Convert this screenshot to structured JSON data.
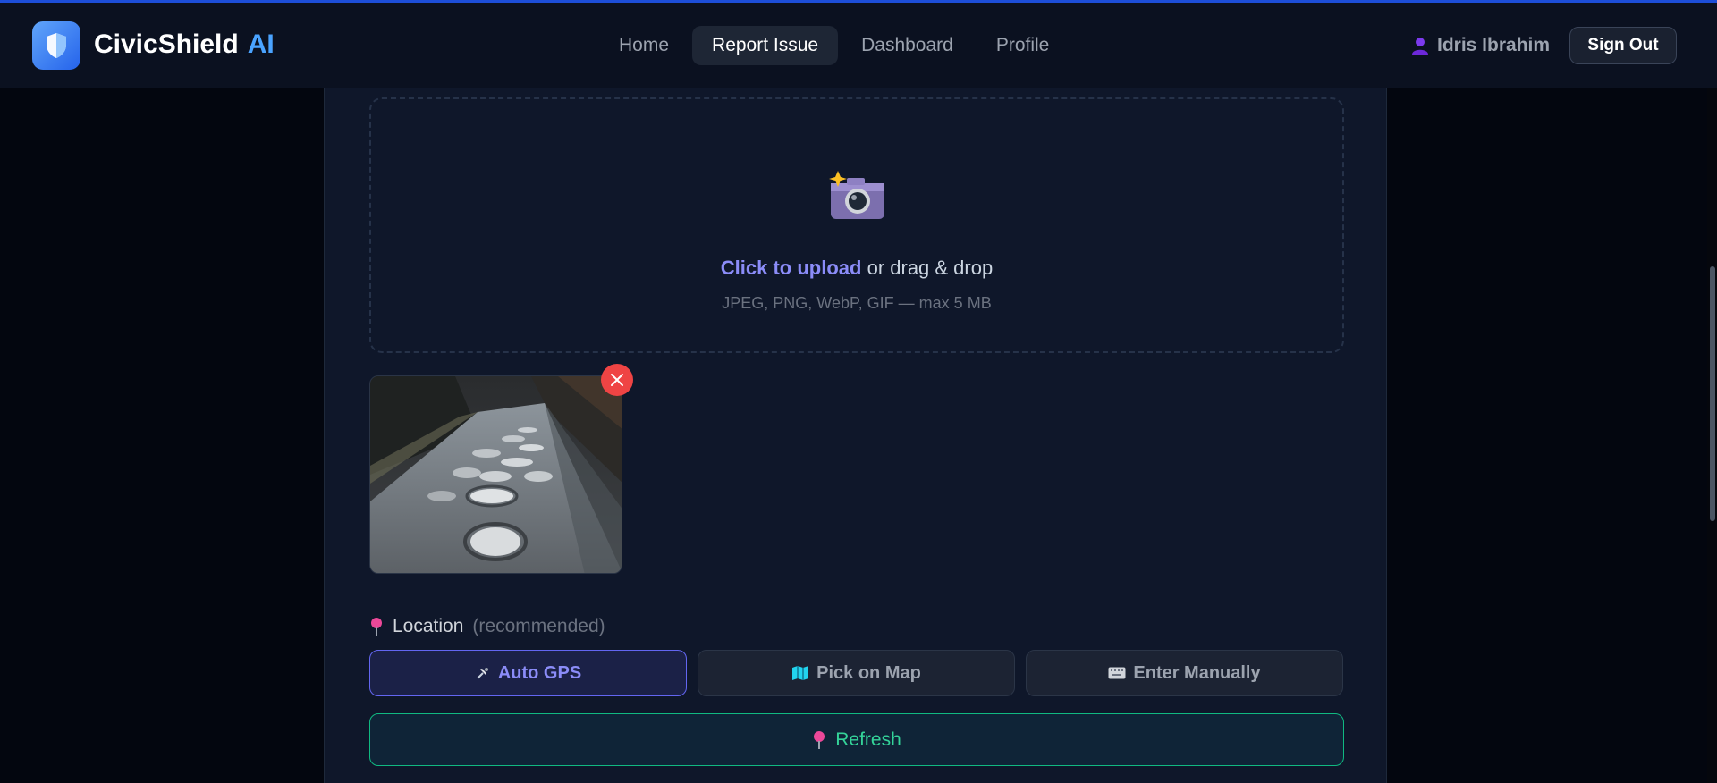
{
  "app": {
    "brand_name": "CivicShield",
    "brand_suffix": "AI",
    "logo_icon": "shield-icon",
    "accent_color": "#4aa3ff"
  },
  "nav": {
    "items": [
      {
        "label": "Home",
        "active": false
      },
      {
        "label": "Report Issue",
        "active": true
      },
      {
        "label": "Dashboard",
        "active": false
      },
      {
        "label": "Profile",
        "active": false
      }
    ]
  },
  "user": {
    "name": "Idris Ibrahim",
    "icon": "user-icon",
    "sign_out_label": "Sign Out"
  },
  "upload": {
    "icon": "camera-icon",
    "link_text": "Click to upload",
    "rest_text": " or drag & drop",
    "hint": "JPEG, PNG, WebP, GIF — max 5 MB"
  },
  "preview": {
    "remove_icon": "close-icon",
    "image_icon": "pothole-road-photo"
  },
  "location": {
    "icon": "pin-icon",
    "label": "Location",
    "hint": "(recommended)",
    "options": [
      {
        "label": "Auto GPS",
        "icon": "satellite-icon",
        "active": true
      },
      {
        "label": "Pick on Map",
        "icon": "map-icon",
        "active": false
      },
      {
        "label": "Enter Manually",
        "icon": "keyboard-icon",
        "active": false
      }
    ],
    "refresh_label": "Refresh",
    "refresh_icon": "pin-icon",
    "refresh_color": "#34d399"
  }
}
